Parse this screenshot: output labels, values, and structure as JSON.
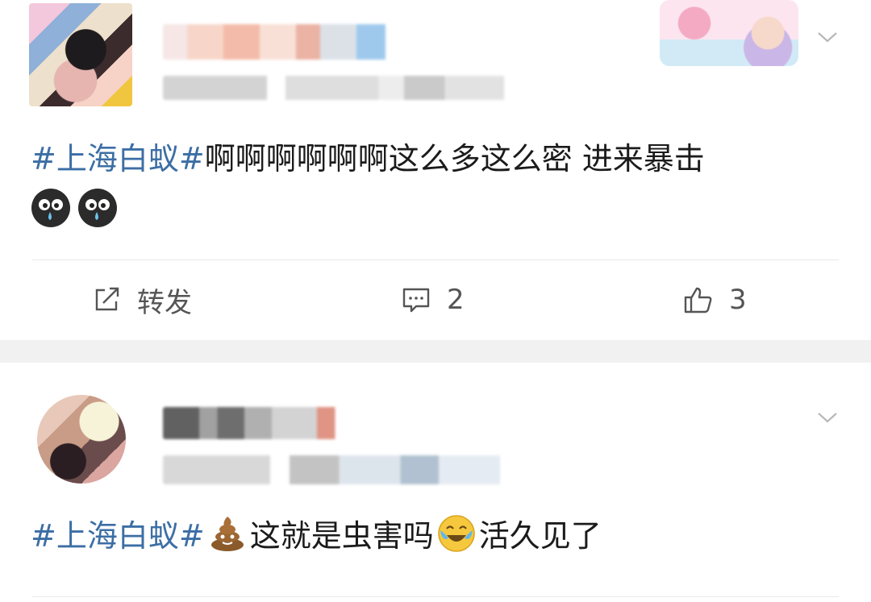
{
  "posts": [
    {
      "hashtag": "#上海白蚁#",
      "text": "啊啊啊啊啊啊这么多这么密 进来暴击",
      "emojis": [
        "crying-emoji",
        "crying-emoji"
      ],
      "actions": {
        "repost_label": "转发",
        "comment_count": "2",
        "like_count": "3"
      }
    },
    {
      "hashtag": "#上海白蚁#",
      "text_before": "这就是虫害吗",
      "text_after": "活久见了",
      "emojis": [
        "poop-emoji",
        "laughing-tears-emoji"
      ]
    }
  ],
  "colors": {
    "hashtag": "#3c6ea5",
    "text": "#1b1b1b",
    "action_text": "#555555",
    "separator": "#f1f1f1"
  }
}
